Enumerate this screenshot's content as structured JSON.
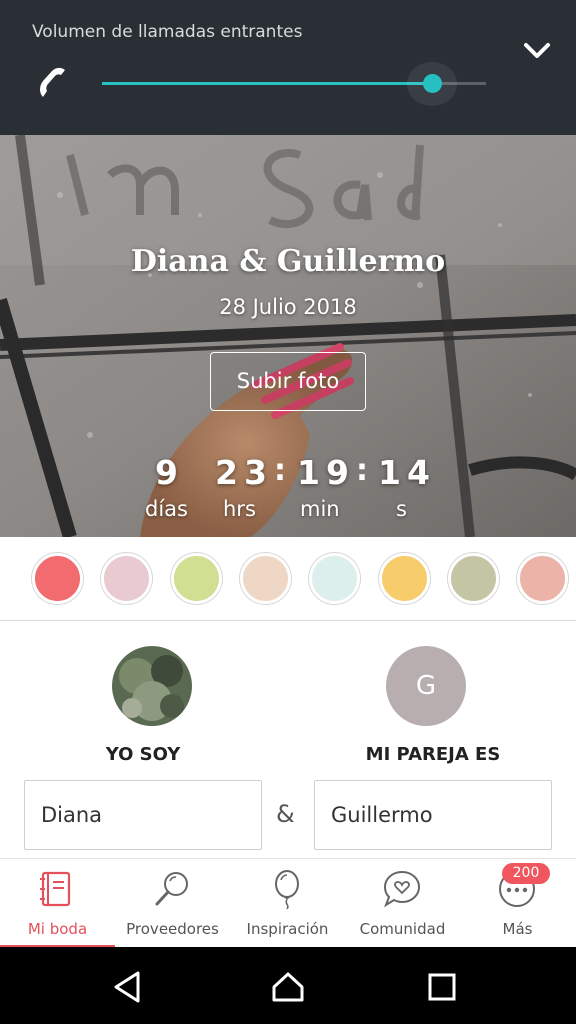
{
  "volume": {
    "title": "Volumen de llamadas entrantes",
    "level": 0.86,
    "accent": "#26c0c3",
    "icon": "phone-icon",
    "collapse_icon": "chevron-down-icon"
  },
  "hero": {
    "couple_names": "Diana & Guillermo",
    "date": "28 Julio 2018",
    "upload_label": "Subir foto",
    "countdown": {
      "days": "9",
      "hours": "23",
      "minutes": "19",
      "seconds": "14",
      "days_label": "días",
      "hours_label": "hrs",
      "minutes_label": "min",
      "seconds_label": "s"
    }
  },
  "palette": [
    "#f26b6e",
    "#e9cad1",
    "#d0df92",
    "#efd7c5",
    "#dcefec",
    "#f7cd6c",
    "#c4c5a5",
    "#ecb3a8"
  ],
  "couple": {
    "me_label": "YO SOY",
    "partner_label": "MI PAREJA ES",
    "me_name": "Diana",
    "partner_name": "Guillermo",
    "partner_initial": "G",
    "separator": "&"
  },
  "tabs": [
    {
      "label": "Mi boda",
      "icon": "wedding-book-icon",
      "active": true
    },
    {
      "label": "Proveedores",
      "icon": "magnifier-icon",
      "active": false
    },
    {
      "label": "Inspiración",
      "icon": "balloon-icon",
      "active": false
    },
    {
      "label": "Comunidad",
      "icon": "chat-heart-icon",
      "active": false
    },
    {
      "label": "Más",
      "icon": "more-icon",
      "active": false
    }
  ],
  "more_badge": "200",
  "accent": "#e3525b",
  "system_nav": [
    "back-icon",
    "home-icon",
    "recents-icon"
  ]
}
